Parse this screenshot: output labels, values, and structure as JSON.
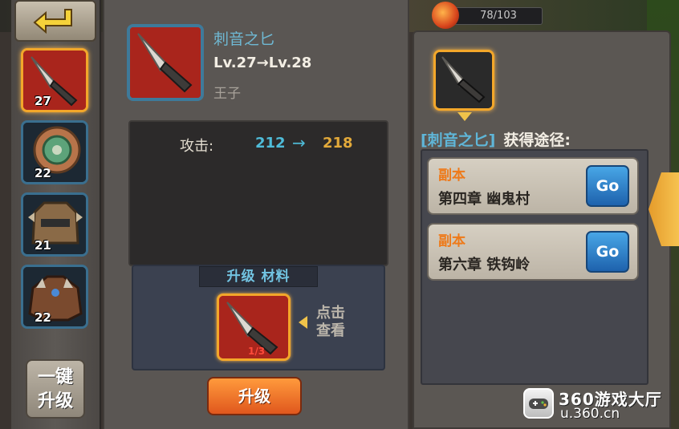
{
  "top_counter": {
    "text": "78/103",
    "icon": "fire-icon"
  },
  "back_button": {
    "icon": "return-arrow-icon"
  },
  "equipment_slots": [
    {
      "level": "27",
      "icon": "dagger-icon",
      "selected": true
    },
    {
      "level": "22",
      "icon": "shield-icon",
      "selected": false
    },
    {
      "level": "21",
      "icon": "helmet-icon",
      "selected": false
    },
    {
      "level": "22",
      "icon": "armor-icon",
      "selected": false
    }
  ],
  "one_key": {
    "line1": "一键",
    "line2": "升级"
  },
  "item": {
    "name": "刺音之匕",
    "level": "Lv.27→Lv.28",
    "type": "王子"
  },
  "stat": {
    "label": "攻击:",
    "from": "212",
    "arrow": "→",
    "to": "218"
  },
  "materials": {
    "title": "升级 材料",
    "count": "1/3",
    "view_text_1": "点击",
    "view_text_2": "查看"
  },
  "upgrade_button": "升级",
  "source": {
    "item_name": "[刺音之匕]",
    "title": "获得途径:",
    "entries": [
      {
        "type": "副本",
        "name": "第四章 幽鬼村",
        "go": "Go"
      },
      {
        "type": "副本",
        "name": "第六章 铁钩岭",
        "go": "Go"
      }
    ]
  },
  "watermark": {
    "title": "360游戏大厅",
    "url": "u.360.cn"
  },
  "colors": {
    "accent_orange": "#f3a72a",
    "blue_text": "#4fbcd9",
    "gold_text": "#e2a93a",
    "go_blue": "#2b7fc8"
  }
}
